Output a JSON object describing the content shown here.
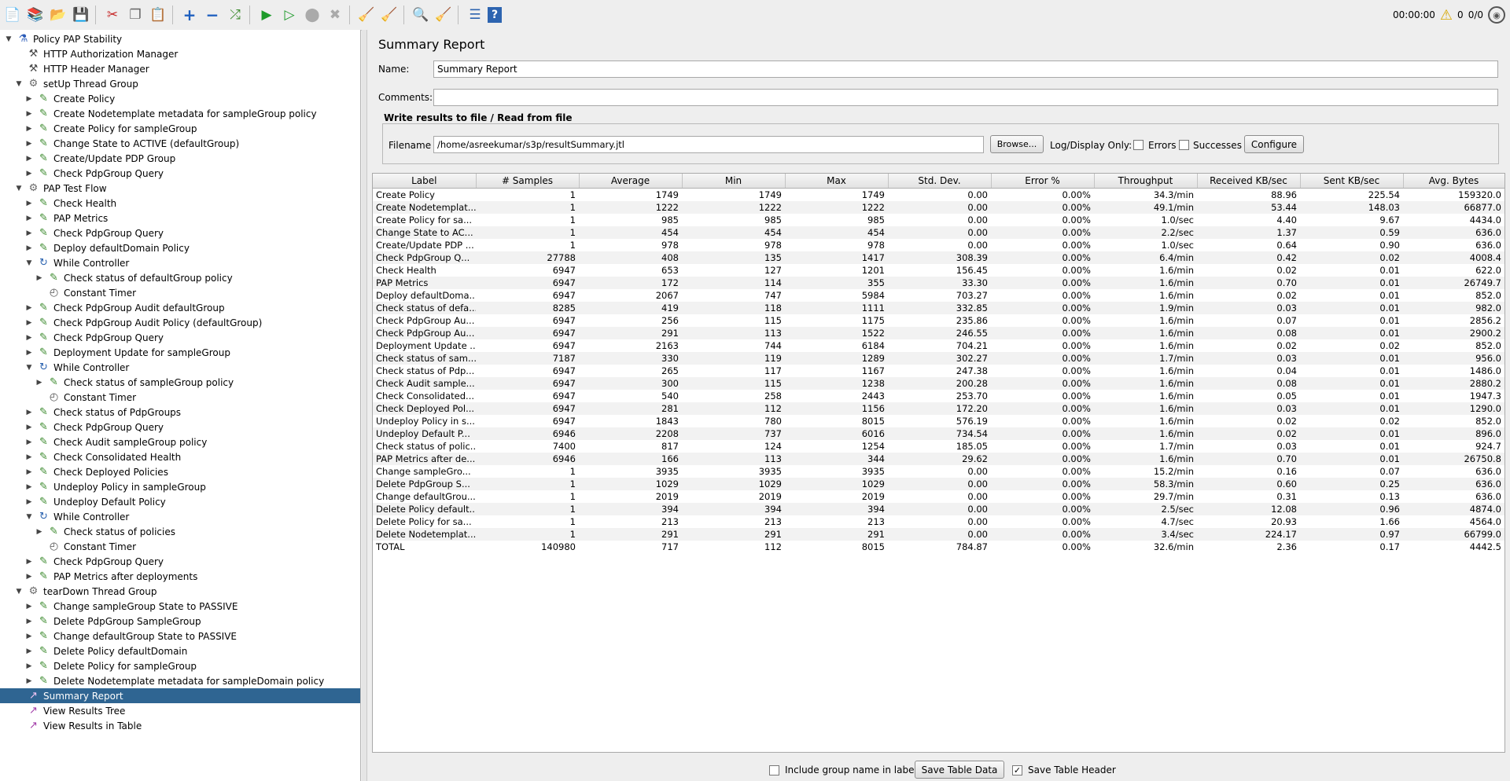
{
  "toolbar": {
    "timer": "00:00:00",
    "warnings": "0",
    "threads": "0/0"
  },
  "tree": [
    {
      "label": "Policy PAP Stability",
      "level": 0,
      "icon": "testplan",
      "toggle": "open"
    },
    {
      "label": "HTTP Authorization Manager",
      "level": 1,
      "icon": "config",
      "toggle": ""
    },
    {
      "label": "HTTP Header Manager",
      "level": 1,
      "icon": "config",
      "toggle": ""
    },
    {
      "label": "setUp Thread Group",
      "level": 1,
      "icon": "threadgroup",
      "toggle": "open"
    },
    {
      "label": "Create Policy",
      "level": 2,
      "icon": "sampler",
      "toggle": "closed"
    },
    {
      "label": "Create Nodetemplate metadata for sampleGroup policy",
      "level": 2,
      "icon": "sampler",
      "toggle": "closed"
    },
    {
      "label": "Create Policy for sampleGroup",
      "level": 2,
      "icon": "sampler",
      "toggle": "closed"
    },
    {
      "label": "Change State to ACTIVE (defaultGroup)",
      "level": 2,
      "icon": "sampler",
      "toggle": "closed"
    },
    {
      "label": "Create/Update PDP Group",
      "level": 2,
      "icon": "sampler",
      "toggle": "closed"
    },
    {
      "label": "Check PdpGroup Query",
      "level": 2,
      "icon": "sampler",
      "toggle": "closed"
    },
    {
      "label": "PAP Test Flow",
      "level": 1,
      "icon": "threadgroup",
      "toggle": "open"
    },
    {
      "label": "Check Health",
      "level": 2,
      "icon": "sampler",
      "toggle": "closed"
    },
    {
      "label": "PAP Metrics",
      "level": 2,
      "icon": "sampler",
      "toggle": "closed"
    },
    {
      "label": "Check PdpGroup Query",
      "level": 2,
      "icon": "sampler",
      "toggle": "closed"
    },
    {
      "label": "Deploy defaultDomain Policy",
      "level": 2,
      "icon": "sampler",
      "toggle": "closed"
    },
    {
      "label": "While Controller",
      "level": 2,
      "icon": "controller",
      "toggle": "open"
    },
    {
      "label": "Check status of defaultGroup policy",
      "level": 3,
      "icon": "sampler",
      "toggle": "closed"
    },
    {
      "label": "Constant Timer",
      "level": 3,
      "icon": "timer",
      "toggle": ""
    },
    {
      "label": "Check PdpGroup Audit defaultGroup",
      "level": 2,
      "icon": "sampler",
      "toggle": "closed"
    },
    {
      "label": "Check PdpGroup Audit Policy (defaultGroup)",
      "level": 2,
      "icon": "sampler",
      "toggle": "closed"
    },
    {
      "label": "Check PdpGroup Query",
      "level": 2,
      "icon": "sampler",
      "toggle": "closed"
    },
    {
      "label": "Deployment Update for sampleGroup",
      "level": 2,
      "icon": "sampler",
      "toggle": "closed"
    },
    {
      "label": "While Controller",
      "level": 2,
      "icon": "controller",
      "toggle": "open"
    },
    {
      "label": "Check status of sampleGroup policy",
      "level": 3,
      "icon": "sampler",
      "toggle": "closed"
    },
    {
      "label": "Constant Timer",
      "level": 3,
      "icon": "timer",
      "toggle": ""
    },
    {
      "label": "Check status of PdpGroups",
      "level": 2,
      "icon": "sampler",
      "toggle": "closed"
    },
    {
      "label": "Check PdpGroup Query",
      "level": 2,
      "icon": "sampler",
      "toggle": "closed"
    },
    {
      "label": "Check Audit sampleGroup policy",
      "level": 2,
      "icon": "sampler",
      "toggle": "closed"
    },
    {
      "label": "Check Consolidated Health",
      "level": 2,
      "icon": "sampler",
      "toggle": "closed"
    },
    {
      "label": "Check Deployed Policies",
      "level": 2,
      "icon": "sampler",
      "toggle": "closed"
    },
    {
      "label": "Undeploy Policy in sampleGroup",
      "level": 2,
      "icon": "sampler",
      "toggle": "closed"
    },
    {
      "label": "Undeploy Default Policy",
      "level": 2,
      "icon": "sampler",
      "toggle": "closed"
    },
    {
      "label": "While Controller",
      "level": 2,
      "icon": "controller",
      "toggle": "open"
    },
    {
      "label": "Check status of policies",
      "level": 3,
      "icon": "sampler",
      "toggle": "closed"
    },
    {
      "label": "Constant Timer",
      "level": 3,
      "icon": "timer",
      "toggle": ""
    },
    {
      "label": "Check PdpGroup Query",
      "level": 2,
      "icon": "sampler",
      "toggle": "closed"
    },
    {
      "label": "PAP Metrics after deployments",
      "level": 2,
      "icon": "sampler",
      "toggle": "closed"
    },
    {
      "label": "tearDown Thread Group",
      "level": 1,
      "icon": "threadgroup",
      "toggle": "open"
    },
    {
      "label": "Change sampleGroup State to PASSIVE",
      "level": 2,
      "icon": "sampler",
      "toggle": "closed"
    },
    {
      "label": "Delete PdpGroup SampleGroup",
      "level": 2,
      "icon": "sampler",
      "toggle": "closed"
    },
    {
      "label": "Change defaultGroup State to PASSIVE",
      "level": 2,
      "icon": "sampler",
      "toggle": "closed"
    },
    {
      "label": "Delete Policy defaultDomain",
      "level": 2,
      "icon": "sampler",
      "toggle": "closed"
    },
    {
      "label": "Delete Policy for sampleGroup",
      "level": 2,
      "icon": "sampler",
      "toggle": "closed"
    },
    {
      "label": "Delete Nodetemplate metadata for sampleDomain policy",
      "level": 2,
      "icon": "sampler",
      "toggle": "closed"
    },
    {
      "label": "Summary Report",
      "level": 1,
      "icon": "listener",
      "toggle": "",
      "selected": true
    },
    {
      "label": "View Results Tree",
      "level": 1,
      "icon": "listener",
      "toggle": ""
    },
    {
      "label": "View Results in Table",
      "level": 1,
      "icon": "listener",
      "toggle": ""
    }
  ],
  "report": {
    "title": "Summary Report",
    "name_label": "Name:",
    "name_value": "Summary Report",
    "comments_label": "Comments:",
    "comments_value": "",
    "file_group_title": "Write results to file / Read from file",
    "filename_label": "Filename",
    "filename_value": "/home/asreekumar/s3p/resultSummary.jtl",
    "browse_label": "Browse...",
    "log_display_label": "Log/Display Only:",
    "errors_label": "Errors",
    "successes_label": "Successes",
    "configure_label": "Configure",
    "include_group_label": "Include group name in label?",
    "save_table_label": "Save Table Data",
    "save_header_label": "Save Table Header"
  },
  "table": {
    "columns": [
      "Label",
      "# Samples",
      "Average",
      "Min",
      "Max",
      "Std. Dev.",
      "Error %",
      "Throughput",
      "Received KB/sec",
      "Sent KB/sec",
      "Avg. Bytes"
    ],
    "rows": [
      [
        "Create Policy",
        "1",
        "1749",
        "1749",
        "1749",
        "0.00",
        "0.00%",
        "34.3/min",
        "88.96",
        "225.54",
        "159320.0"
      ],
      [
        "Create Nodetemplat...",
        "1",
        "1222",
        "1222",
        "1222",
        "0.00",
        "0.00%",
        "49.1/min",
        "53.44",
        "148.03",
        "66877.0"
      ],
      [
        "Create Policy for sa...",
        "1",
        "985",
        "985",
        "985",
        "0.00",
        "0.00%",
        "1.0/sec",
        "4.40",
        "9.67",
        "4434.0"
      ],
      [
        "Change State to AC...",
        "1",
        "454",
        "454",
        "454",
        "0.00",
        "0.00%",
        "2.2/sec",
        "1.37",
        "0.59",
        "636.0"
      ],
      [
        "Create/Update PDP ...",
        "1",
        "978",
        "978",
        "978",
        "0.00",
        "0.00%",
        "1.0/sec",
        "0.64",
        "0.90",
        "636.0"
      ],
      [
        "Check PdpGroup Q...",
        "27788",
        "408",
        "135",
        "1417",
        "308.39",
        "0.00%",
        "6.4/min",
        "0.42",
        "0.02",
        "4008.4"
      ],
      [
        "Check Health",
        "6947",
        "653",
        "127",
        "1201",
        "156.45",
        "0.00%",
        "1.6/min",
        "0.02",
        "0.01",
        "622.0"
      ],
      [
        "PAP Metrics",
        "6947",
        "172",
        "114",
        "355",
        "33.30",
        "0.00%",
        "1.6/min",
        "0.70",
        "0.01",
        "26749.7"
      ],
      [
        "Deploy defaultDoma...",
        "6947",
        "2067",
        "747",
        "5984",
        "703.27",
        "0.00%",
        "1.6/min",
        "0.02",
        "0.01",
        "852.0"
      ],
      [
        "Check status of defa...",
        "8285",
        "419",
        "118",
        "1111",
        "332.85",
        "0.00%",
        "1.9/min",
        "0.03",
        "0.01",
        "982.0"
      ],
      [
        "Check PdpGroup Au...",
        "6947",
        "256",
        "115",
        "1175",
        "235.86",
        "0.00%",
        "1.6/min",
        "0.07",
        "0.01",
        "2856.2"
      ],
      [
        "Check PdpGroup Au...",
        "6947",
        "291",
        "113",
        "1522",
        "246.55",
        "0.00%",
        "1.6/min",
        "0.08",
        "0.01",
        "2900.2"
      ],
      [
        "Deployment Update ...",
        "6947",
        "2163",
        "744",
        "6184",
        "704.21",
        "0.00%",
        "1.6/min",
        "0.02",
        "0.02",
        "852.0"
      ],
      [
        "Check status of sam...",
        "7187",
        "330",
        "119",
        "1289",
        "302.27",
        "0.00%",
        "1.7/min",
        "0.03",
        "0.01",
        "956.0"
      ],
      [
        "Check status of Pdp...",
        "6947",
        "265",
        "117",
        "1167",
        "247.38",
        "0.00%",
        "1.6/min",
        "0.04",
        "0.01",
        "1486.0"
      ],
      [
        "Check Audit sample...",
        "6947",
        "300",
        "115",
        "1238",
        "200.28",
        "0.00%",
        "1.6/min",
        "0.08",
        "0.01",
        "2880.2"
      ],
      [
        "Check Consolidated...",
        "6947",
        "540",
        "258",
        "2443",
        "253.70",
        "0.00%",
        "1.6/min",
        "0.05",
        "0.01",
        "1947.3"
      ],
      [
        "Check Deployed Pol...",
        "6947",
        "281",
        "112",
        "1156",
        "172.20",
        "0.00%",
        "1.6/min",
        "0.03",
        "0.01",
        "1290.0"
      ],
      [
        "Undeploy Policy in s...",
        "6947",
        "1843",
        "780",
        "8015",
        "576.19",
        "0.00%",
        "1.6/min",
        "0.02",
        "0.02",
        "852.0"
      ],
      [
        "Undeploy Default P...",
        "6946",
        "2208",
        "737",
        "6016",
        "734.54",
        "0.00%",
        "1.6/min",
        "0.02",
        "0.01",
        "896.0"
      ],
      [
        "Check status of polic...",
        "7400",
        "817",
        "124",
        "1254",
        "185.05",
        "0.00%",
        "1.7/min",
        "0.03",
        "0.01",
        "924.7"
      ],
      [
        "PAP Metrics after de...",
        "6946",
        "166",
        "113",
        "344",
        "29.62",
        "0.00%",
        "1.6/min",
        "0.70",
        "0.01",
        "26750.8"
      ],
      [
        "Change sampleGro...",
        "1",
        "3935",
        "3935",
        "3935",
        "0.00",
        "0.00%",
        "15.2/min",
        "0.16",
        "0.07",
        "636.0"
      ],
      [
        "Delete PdpGroup S...",
        "1",
        "1029",
        "1029",
        "1029",
        "0.00",
        "0.00%",
        "58.3/min",
        "0.60",
        "0.25",
        "636.0"
      ],
      [
        "Change defaultGrou...",
        "1",
        "2019",
        "2019",
        "2019",
        "0.00",
        "0.00%",
        "29.7/min",
        "0.31",
        "0.13",
        "636.0"
      ],
      [
        "Delete Policy default...",
        "1",
        "394",
        "394",
        "394",
        "0.00",
        "0.00%",
        "2.5/sec",
        "12.08",
        "0.96",
        "4874.0"
      ],
      [
        "Delete Policy for sa...",
        "1",
        "213",
        "213",
        "213",
        "0.00",
        "0.00%",
        "4.7/sec",
        "20.93",
        "1.66",
        "4564.0"
      ],
      [
        "Delete Nodetemplat...",
        "1",
        "291",
        "291",
        "291",
        "0.00",
        "0.00%",
        "3.4/sec",
        "224.17",
        "0.97",
        "66799.0"
      ],
      [
        "TOTAL",
        "140980",
        "717",
        "112",
        "8015",
        "784.87",
        "0.00%",
        "32.6/min",
        "2.36",
        "0.17",
        "4442.5"
      ]
    ]
  }
}
